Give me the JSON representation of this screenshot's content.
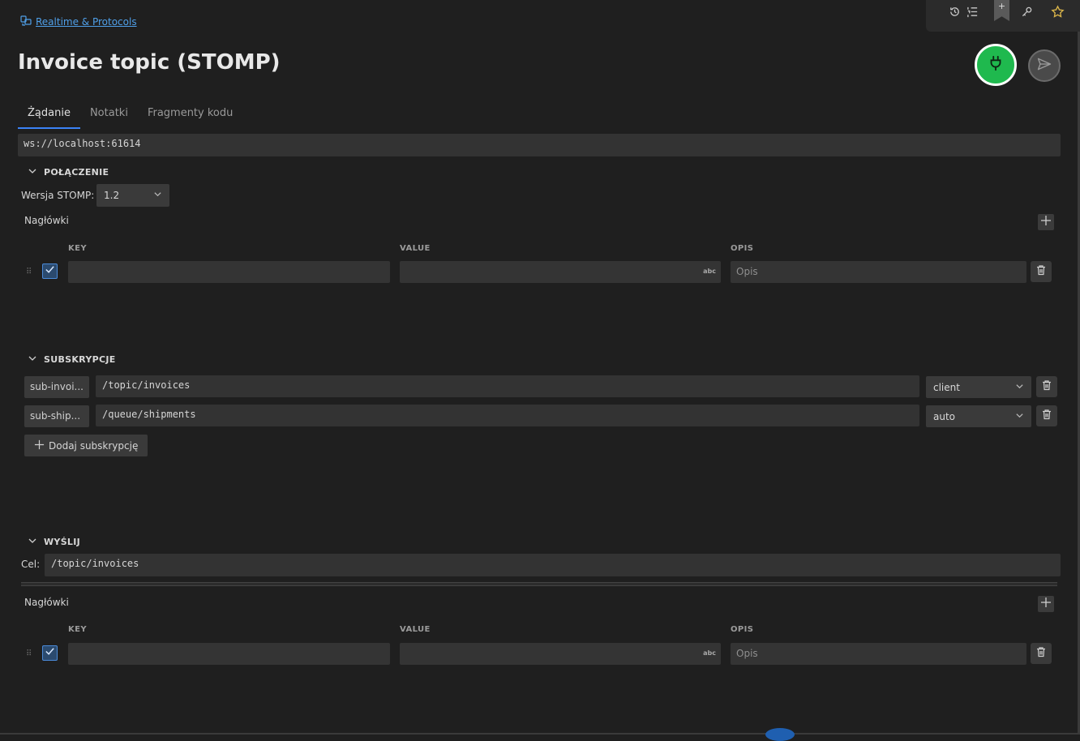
{
  "breadcrumb": {
    "label": "Realtime & Protocols",
    "icon": "protocols-icon"
  },
  "toolbar": {
    "bookmark_symbol": "+"
  },
  "page": {
    "title": "Invoice topic (STOMP)"
  },
  "tabs": [
    {
      "label": "Żądanie",
      "active": true
    },
    {
      "label": "Notatki",
      "active": false
    },
    {
      "label": "Fragmenty kodu",
      "active": false
    }
  ],
  "url": "ws://localhost:61614",
  "connection": {
    "title": "POŁĄCZENIE",
    "version_label": "Wersja STOMP:",
    "version_value": "1.2",
    "headers_label": "Nagłówki",
    "columns": {
      "key": "KEY",
      "value": "VALUE",
      "desc": "OPIS"
    },
    "row": {
      "key": "",
      "value": "",
      "desc_placeholder": "Opis",
      "value_badge": "abc",
      "checked": true
    }
  },
  "subscriptions": {
    "title": "SUBSKRYPCJE",
    "items": [
      {
        "id": "sub-invoi...",
        "destination": "/topic/invoices",
        "ack": "client"
      },
      {
        "id": "sub-ship...",
        "destination": "/queue/shipments",
        "ack": "auto"
      }
    ],
    "add_label": "Dodaj subskrypcję"
  },
  "send": {
    "title": "WYŚLIJ",
    "target_label": "Cel:",
    "target_value": "/topic/invoices",
    "headers_label": "Nagłówki",
    "columns": {
      "key": "KEY",
      "value": "VALUE",
      "desc": "OPIS"
    },
    "row": {
      "key": "",
      "value": "",
      "desc_placeholder": "Opis",
      "value_badge": "abc",
      "checked": true
    }
  },
  "colors": {
    "accent": "#3b82f6",
    "connect": "#1fb94e",
    "link": "#4f9fe8",
    "background": "#1f1f1f"
  }
}
